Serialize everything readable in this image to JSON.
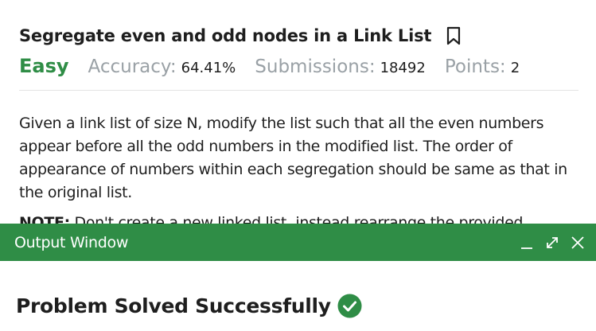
{
  "problem": {
    "title": "Segregate even and odd nodes in a Link List",
    "bookmark_icon": "bookmark-icon",
    "difficulty": "Easy",
    "accuracy_label": "Accuracy:",
    "accuracy_value": "64.41%",
    "submissions_label": "Submissions:",
    "submissions_value": "18492",
    "points_label": "Points:",
    "points_value": "2",
    "description": "Given a link list of size N, modify the list such that all the even numbers appear before all the odd numbers in the modified list. The order of appearance of numbers within each segregation should be same as that in the original list.",
    "note_label": "NOTE:",
    "note_text": " Don't create a new linked list, instead rearrange the provided"
  },
  "output_window": {
    "title": "Output Window",
    "minimize_icon": "minimize-icon",
    "expand_icon": "expand-icon",
    "close_icon": "close-icon",
    "result_text": "Problem Solved Successfully",
    "result_icon": "check-circle-icon"
  },
  "colors": {
    "brand_green": "#2f8d46",
    "muted_gray": "#9aa1a6",
    "text_dark": "#1e1e1e"
  }
}
